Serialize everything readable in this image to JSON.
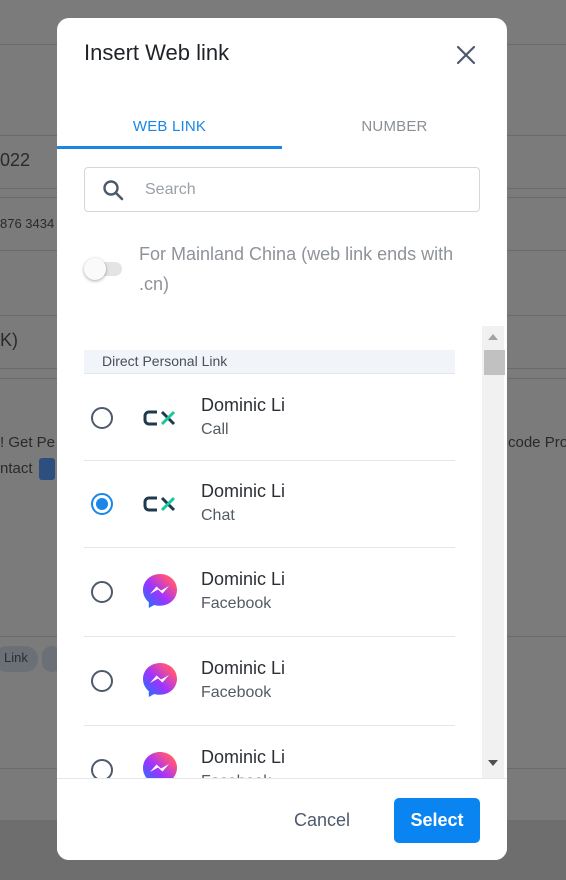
{
  "background": {
    "texts": [
      "022",
      "876 3434",
      "K)",
      "! Get Pe",
      "code Pro",
      "ntact"
    ],
    "chips": [
      "Link"
    ]
  },
  "dialog": {
    "title": "Insert Web link",
    "tabs": [
      {
        "label": "WEB LINK",
        "active": true
      },
      {
        "label": "NUMBER",
        "active": false
      }
    ],
    "search": {
      "placeholder": "Search",
      "value": ""
    },
    "toggle": {
      "label": "For Mainland China (web link ends with .cn)",
      "on": false
    },
    "list": {
      "section_header": "Direct Personal Link",
      "items": [
        {
          "name": "Dominic Li",
          "type": "Call",
          "icon": "cx-icon",
          "selected": false
        },
        {
          "name": "Dominic Li",
          "type": "Chat",
          "icon": "cx-icon",
          "selected": true
        },
        {
          "name": "Dominic Li",
          "type": "Facebook",
          "icon": "messenger-icon",
          "selected": false
        },
        {
          "name": "Dominic Li",
          "type": "Facebook",
          "icon": "messenger-icon",
          "selected": false
        },
        {
          "name": "Dominic Li",
          "type": "Facebook",
          "icon": "messenger-icon",
          "selected": false
        }
      ]
    },
    "footer": {
      "cancel_label": "Cancel",
      "select_label": "Select"
    }
  },
  "colors": {
    "accent": "#1a86e8",
    "primary_button": "#0a84f0"
  }
}
